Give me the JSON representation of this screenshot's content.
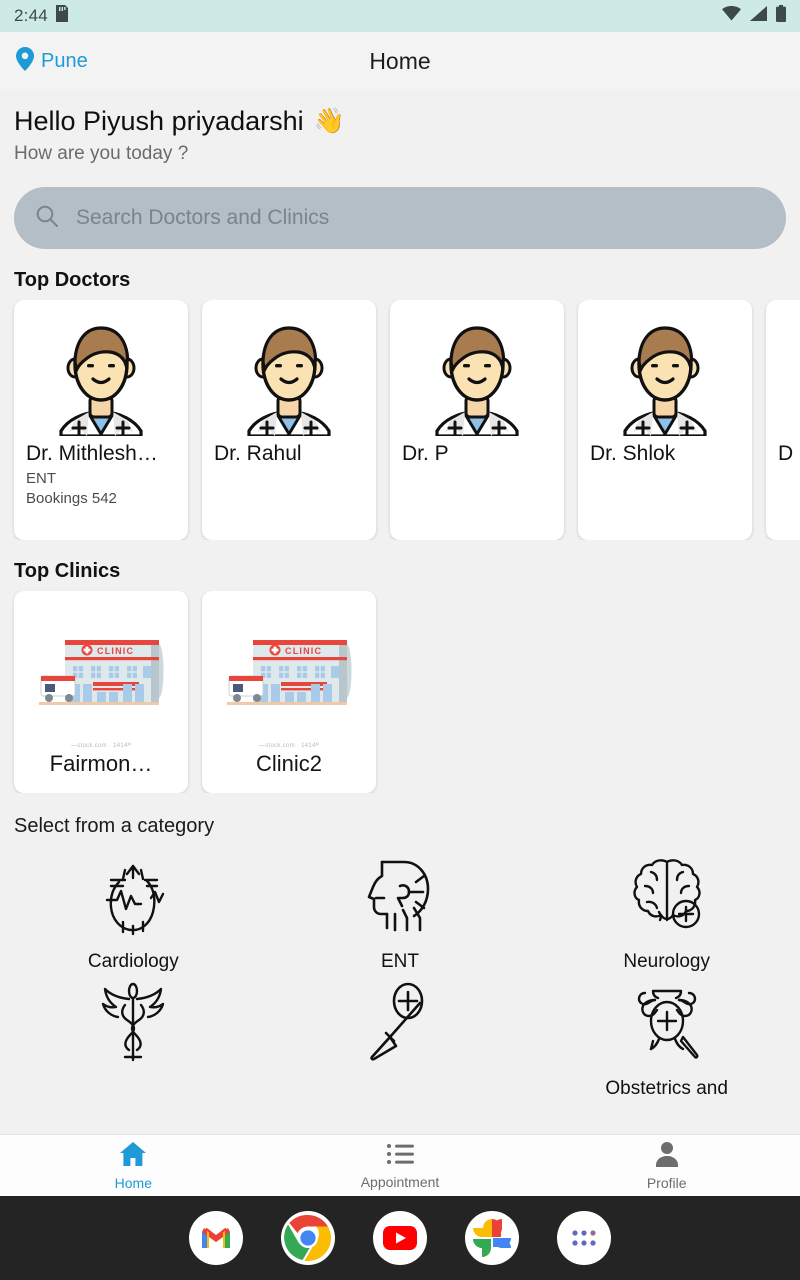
{
  "statusbar": {
    "time": "2:44",
    "icons": [
      "sd-card-icon",
      "wifi-icon",
      "signal-icon",
      "battery-icon"
    ]
  },
  "appbar": {
    "location": "Pune",
    "title": "Home"
  },
  "greeting": {
    "hello": "Hello Piyush priyadarshi",
    "emoji": "👋",
    "sub": "How are you today ?"
  },
  "search": {
    "placeholder": "Search Doctors and Clinics",
    "value": ""
  },
  "sections": {
    "doctors_title": "Top Doctors",
    "clinics_title": "Top Clinics",
    "categories_title": "Select from a category"
  },
  "doctors": [
    {
      "name": "Dr. Mithlesh…",
      "specialty": "ENT",
      "bookings": "Bookings 542"
    },
    {
      "name": "Dr. Rahul",
      "specialty": "",
      "bookings": ""
    },
    {
      "name": "Dr. P",
      "specialty": "",
      "bookings": ""
    },
    {
      "name": "Dr. Shlok",
      "specialty": "",
      "bookings": ""
    },
    {
      "name": "D",
      "specialty": "",
      "bookings": ""
    }
  ],
  "clinics": [
    {
      "name": "Fairmon…",
      "watermark": "—stock.com · 1414ᴹ"
    },
    {
      "name": "Clinic2",
      "watermark": "—stock.com · 1414ᴹ"
    }
  ],
  "categories": [
    {
      "label": "Cardiology",
      "icon": "heart-icon"
    },
    {
      "label": "ENT",
      "icon": "ear-nose-throat-icon"
    },
    {
      "label": "Neurology",
      "icon": "brain-icon"
    },
    {
      "label": "",
      "icon": "caduceus-icon"
    },
    {
      "label": "",
      "icon": "scalpel-icon"
    },
    {
      "label": "Obstetrics and",
      "icon": "obstetrics-icon"
    }
  ],
  "bottomnav": [
    {
      "label": "Home",
      "icon": "home-icon",
      "active": true
    },
    {
      "label": "Appointment",
      "icon": "list-icon",
      "active": false
    },
    {
      "label": "Profile",
      "icon": "person-icon",
      "active": false
    }
  ],
  "dock": [
    {
      "name": "gmail-icon"
    },
    {
      "name": "chrome-icon"
    },
    {
      "name": "youtube-icon"
    },
    {
      "name": "google-photos-icon"
    },
    {
      "name": "app-drawer-icon"
    }
  ],
  "colors": {
    "accent": "#1e9bd7",
    "statusbar": "#cdeae6",
    "page_bg": "#f1f1f1",
    "search_bg": "#b4bec6"
  }
}
